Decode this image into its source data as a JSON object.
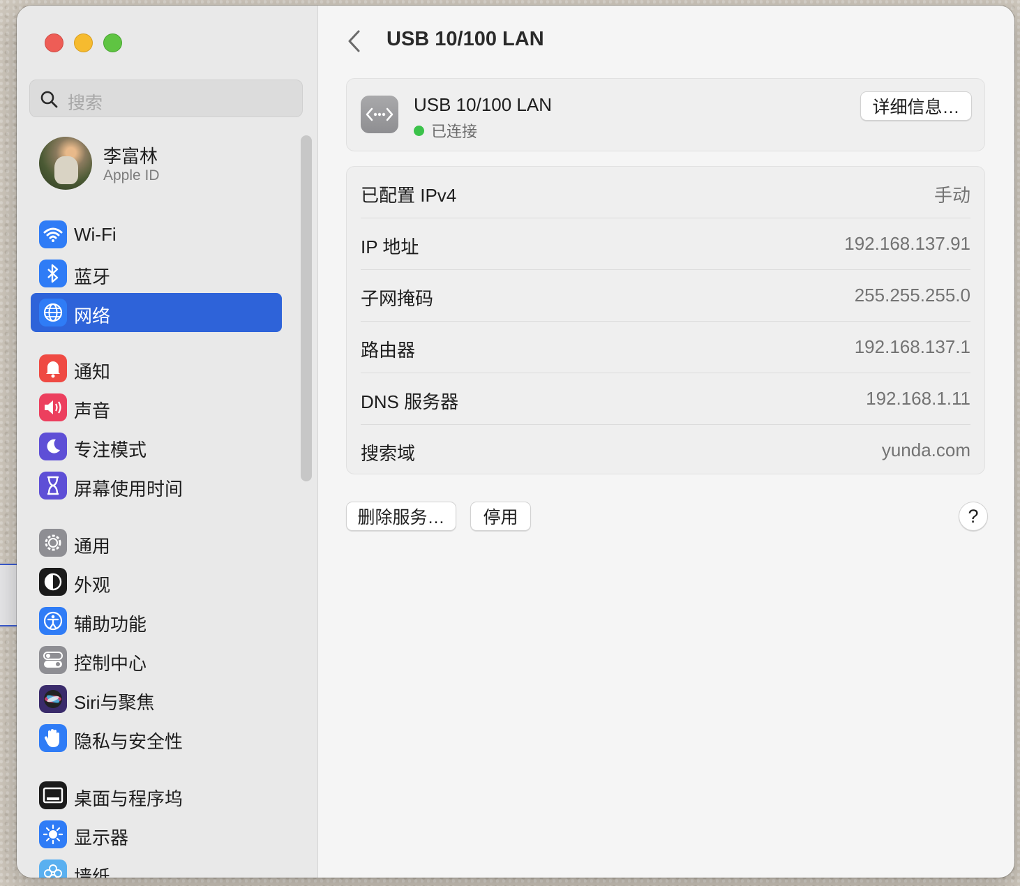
{
  "window": {
    "search": {
      "placeholder": "搜索",
      "icon": "search-icon"
    },
    "profile": {
      "name": "李富林",
      "subtitle": "Apple ID"
    }
  },
  "sidebar": {
    "groups": [
      [
        {
          "label": "Wi-Fi",
          "icon": "wifi-icon",
          "color": "#2f7cf6"
        },
        {
          "label": "蓝牙",
          "icon": "bluetooth-icon",
          "color": "#2f7cf6"
        },
        {
          "label": "网络",
          "icon": "globe-icon",
          "color": "#2f7cf6",
          "active": true
        }
      ],
      [
        {
          "label": "通知",
          "icon": "bell-icon",
          "color": "#ef4a43"
        },
        {
          "label": "声音",
          "icon": "speaker-icon",
          "color": "#ec3f5e"
        },
        {
          "label": "专注模式",
          "icon": "moon-icon",
          "color": "#5e4fd6"
        },
        {
          "label": "屏幕使用时间",
          "icon": "hourglass-icon",
          "color": "#5e4fd6"
        }
      ],
      [
        {
          "label": "通用",
          "icon": "gear-icon",
          "color": "#8e8e93"
        },
        {
          "label": "外观",
          "icon": "appearance-icon",
          "color": "#1b1b1b"
        },
        {
          "label": "辅助功能",
          "icon": "accessibility-icon",
          "color": "#2f7cf6"
        },
        {
          "label": "控制中心",
          "icon": "control-center-icon",
          "color": "#8e8e93"
        },
        {
          "label": "Siri与聚焦",
          "icon": "siri-icon",
          "color": "#3a2b6b"
        },
        {
          "label": "隐私与安全性",
          "icon": "hand-icon",
          "color": "#2f7cf6"
        }
      ],
      [
        {
          "label": "桌面与程序坞",
          "icon": "dock-icon",
          "color": "#1b1b1b"
        },
        {
          "label": "显示器",
          "icon": "sun-icon",
          "color": "#2f7cf6"
        },
        {
          "label": "墙纸",
          "icon": "flower-icon",
          "color": "#5ab0f0"
        }
      ]
    ]
  },
  "main": {
    "title": "USB 10/100 LAN",
    "service": {
      "name": "USB 10/100 LAN",
      "status": "已连接",
      "status_color": "#3bc24a",
      "details_button": "详细信息…"
    },
    "rows": [
      {
        "key": "已配置 IPv4",
        "value": "手动"
      },
      {
        "key": "IP 地址",
        "value": "192.168.137.91"
      },
      {
        "key": "子网掩码",
        "value": "255.255.255.0"
      },
      {
        "key": "路由器",
        "value": "192.168.137.1"
      },
      {
        "key": "DNS 服务器",
        "value": "192.168.1.11"
      },
      {
        "key": "搜索域",
        "value": "yunda.com"
      }
    ],
    "buttons": {
      "delete": "删除服务…",
      "disable": "停用",
      "help": "?"
    }
  }
}
